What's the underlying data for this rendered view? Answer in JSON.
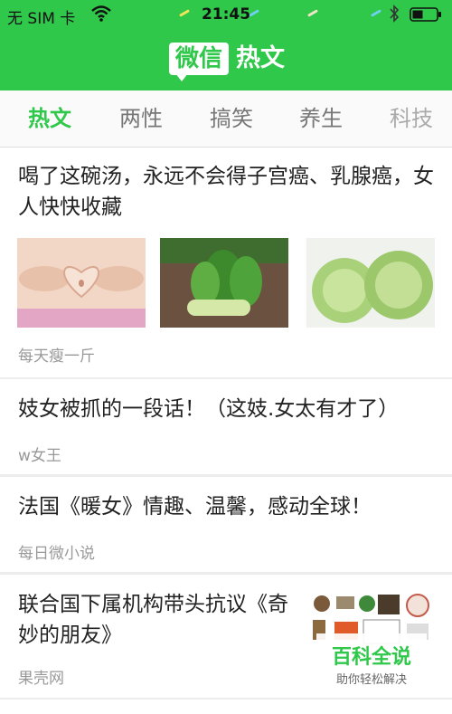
{
  "status_bar": {
    "carrier": "无 SIM 卡",
    "time": "21:45",
    "wifi_icon": "wifi-icon",
    "bluetooth_icon": "bluetooth-icon",
    "battery_icon": "battery-icon"
  },
  "header": {
    "logo_text": "微信",
    "title": "热文"
  },
  "tabs": [
    {
      "label": "热文",
      "active": true
    },
    {
      "label": "两性",
      "active": false
    },
    {
      "label": "搞笑",
      "active": false
    },
    {
      "label": "养生",
      "active": false
    },
    {
      "label": "科技",
      "active": false
    }
  ],
  "articles": [
    {
      "title": "喝了这碗汤，永远不会得子宫癌、乳腺癌，女人快快收藏",
      "source": "每天瘦一斤",
      "images": [
        "belly-heart-hands-photo",
        "bok-choy-photo",
        "cabbage-photo"
      ]
    },
    {
      "title": "妓女被抓的一段话！（这妓.女太有才了）",
      "source": "w女王"
    },
    {
      "title": "法国《暖女》情趣、温馨，感动全球！",
      "source": "每日微小说"
    },
    {
      "title": "联合国下属机构带头抗议《奇妙的朋友》",
      "source": "果壳网",
      "thumbnail": "organization-logos-collage"
    }
  ],
  "watermark": {
    "title": "百科全说",
    "subtitle": "助你轻松解决"
  },
  "colors": {
    "brand_green": "#2fc84a",
    "text_dark": "#222222",
    "text_muted": "#999999"
  }
}
